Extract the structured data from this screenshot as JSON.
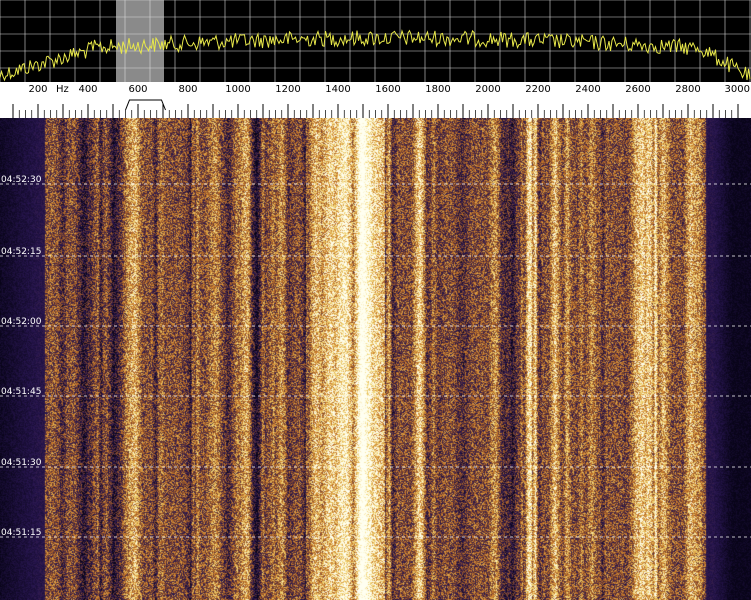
{
  "spectrum": {
    "trace_color": "#e8e84a",
    "grid_color": "#d9d9d9",
    "passband_color": "#8a8a8a",
    "passband_hz": [
      560,
      760
    ]
  },
  "scale": {
    "min_hz": 100,
    "max_hz": 3000,
    "unit": "Hz",
    "labels": [
      {
        "hz": 200,
        "text": "200"
      },
      {
        "hz": 400,
        "text": "400"
      },
      {
        "hz": 600,
        "text": "600"
      },
      {
        "hz": 800,
        "text": "800"
      },
      {
        "hz": 1000,
        "text": "1000"
      },
      {
        "hz": 1200,
        "text": "1200"
      },
      {
        "hz": 1400,
        "text": "1400"
      },
      {
        "hz": 1600,
        "text": "1600"
      },
      {
        "hz": 1800,
        "text": "1800"
      },
      {
        "hz": 2000,
        "text": "2000"
      },
      {
        "hz": 2200,
        "text": "2200"
      },
      {
        "hz": 2400,
        "text": "2400"
      },
      {
        "hz": 2600,
        "text": "2600"
      },
      {
        "hz": 2800,
        "text": "2800"
      },
      {
        "hz": 3000,
        "text": "3000"
      }
    ],
    "bracket_hz": [
      550,
      710
    ]
  },
  "waterfall": {
    "timestamps": [
      "04:52:30",
      "04:52:15",
      "04:52:00",
      "04:51:45",
      "04:51:30",
      "04:51:15"
    ],
    "signal_band_hz": [
      240,
      2900
    ]
  }
}
